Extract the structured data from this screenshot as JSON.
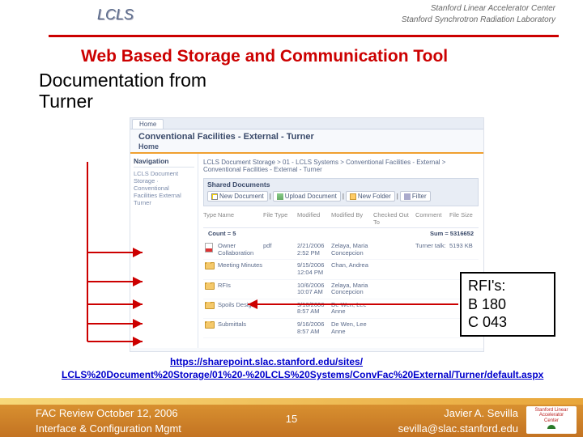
{
  "header": {
    "logo": "LCLS",
    "right1": "Stanford Linear Accelerator Center",
    "right2": "Stanford Synchrotron Radiation Laboratory"
  },
  "title_a": "Web Based",
  "title_b": "Storage and Communication Tool",
  "subtitle": "Documentation from\nTurner",
  "sp": {
    "tab": "Home",
    "title": "Conventional Facilities - External - Turner",
    "home": "Home",
    "nav_h": "Navigation",
    "nav_p": "LCLS Document Storage  ·  Conventional Facilities  External  Turner",
    "breadcrumb": "LCLS Document Storage > 01 - LCLS Systems > Conventional Facilities - External > Conventional Facilities - External - Turner",
    "bar_h": "Shared Documents",
    "btn_new": "New Document",
    "btn_up": "Upload Document",
    "btn_folder": "New Folder",
    "btn_filter": "Filter",
    "hdr": [
      "Type",
      "Name",
      "File Type",
      "Modified",
      "Modified By",
      "Checked Out To",
      "Comment",
      "File Size"
    ],
    "count": "Count = 5",
    "sum": "Sum = 5316652",
    "rows": [
      {
        "ico": "pdf",
        "name": "Owner Collaboration",
        "ftype": "pdf",
        "mod": "2/21/2006 2:52 PM",
        "by": "Zelaya, Maria Concepcion",
        "chk": "",
        "cmt": "Turner talk:",
        "size": "5193 KB"
      },
      {
        "ico": "folder",
        "name": "Meeting Minutes",
        "ftype": "",
        "mod": "9/15/2006 12:04 PM",
        "by": "Chan, Andrea",
        "chk": "",
        "cmt": "",
        "size": ""
      },
      {
        "ico": "folder",
        "name": "RFIs",
        "ftype": "",
        "mod": "10/6/2006 10:07 AM",
        "by": "Zelaya, Maria Concepcion",
        "chk": "",
        "cmt": "",
        "size": ""
      },
      {
        "ico": "folder",
        "name": "Spoils Design",
        "ftype": "",
        "mod": "9/16/2006 8:57 AM",
        "by": "De Wen, Lee Anne",
        "chk": "",
        "cmt": "",
        "size": ""
      },
      {
        "ico": "folder",
        "name": "Submittals",
        "ftype": "",
        "mod": "9/16/2006 8:57 AM",
        "by": "De Wen, Lee Anne",
        "chk": "",
        "cmt": "",
        "size": ""
      }
    ]
  },
  "rfi": {
    "l1": "RFI's:",
    "l2": "B 180",
    "l3": "C 043"
  },
  "url1": "https://sharepoint.slac.stanford.edu/sites/",
  "url2": "LCLS%20Document%20Storage/01%20-%20LCLS%20Systems/ConvFac%20External/Turner/default.aspx",
  "foot": {
    "l1": "FAC Review October 12, 2006",
    "l2": "Interface & Configuration Mgmt",
    "pg": "15",
    "r1": "Javier A. Sevilla",
    "r2": "sevilla@slac.stanford.edu",
    "logo1": "Stanford Linear",
    "logo2": "Accelerator",
    "logo3": "Center"
  }
}
